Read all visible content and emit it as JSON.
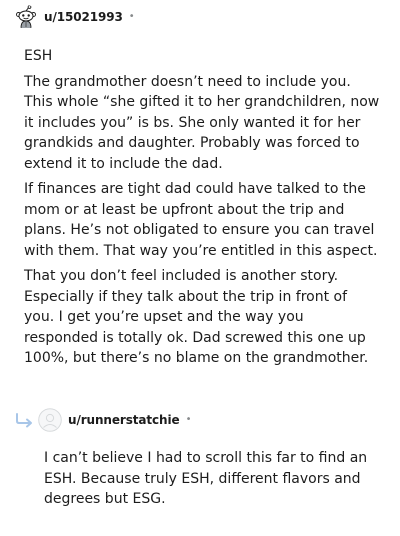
{
  "comment": {
    "username": "u/15021993",
    "separator": "•",
    "avatar_icon": "snoo-avatar-icon",
    "paragraphs": [
      "ESH",
      "The grandmother doesn’t need to include you. This whole “she gifted it to her grandchildren, now it includes you” is bs. She only wanted it for her grandkids and daughter. Probably was forced to extend it to include the dad.",
      "If finances are tight dad could have talked to the mom or at least be upfront about the trip and plans. He’s not obligated to ensure you can travel with them. That way you’re entitled in this aspect.",
      "That you don’t feel included is another story. Especially if they talk about the trip in front of you. I get you’re upset and the way you responded is totally ok. Dad screwed this one up 100%, but there’s no blame on the grandmother."
    ]
  },
  "reply": {
    "username": "u/runnerstatchie",
    "separator": "•",
    "arrow_icon": "reply-arrow-icon",
    "avatar_icon": "default-avatar-icon",
    "paragraphs": [
      "I can’t believe I had to scroll this far to find an ESH. Because truly ESH, different flavors and degrees but ESG."
    ]
  },
  "colors": {
    "text": "#1c1c1c",
    "meta": "#878a8c",
    "reply_arrow": "#a8c6e8"
  }
}
